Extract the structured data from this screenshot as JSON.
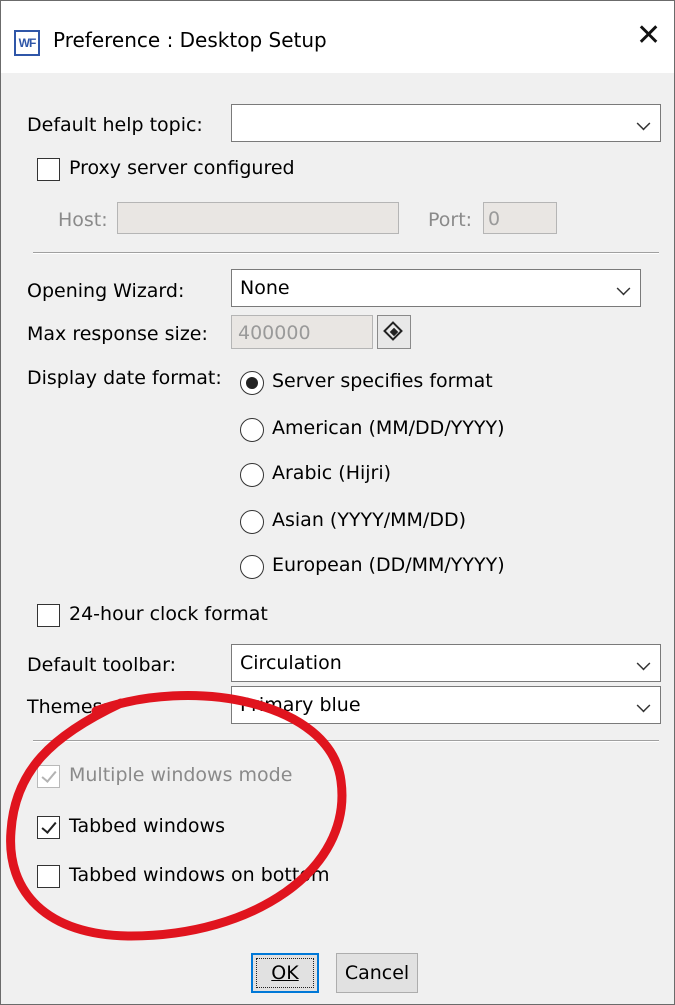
{
  "window": {
    "app_icon_text": "WF",
    "title": "Preference : Desktop Setup",
    "close_glyph": "✕"
  },
  "help": {
    "label": "Default help topic:",
    "value": ""
  },
  "proxy": {
    "label": "Proxy server configured",
    "checked": false,
    "host_label": "Host:",
    "host_value": "",
    "port_label": "Port:",
    "port_value": "0"
  },
  "wizard": {
    "label": "Opening Wizard:",
    "value": "None"
  },
  "max_response": {
    "label": "Max response size:",
    "value": "400000"
  },
  "date_format": {
    "label": "Display date format:",
    "options": [
      {
        "label": "Server specifies format",
        "selected": true
      },
      {
        "label": "American (MM/DD/YYYY)",
        "selected": false
      },
      {
        "label": "Arabic (Hijri)",
        "selected": false
      },
      {
        "label": "Asian (YYYY/MM/DD)",
        "selected": false
      },
      {
        "label": "European (DD/MM/YYYY)",
        "selected": false
      }
    ]
  },
  "clock": {
    "label": "24-hour clock format",
    "checked": false
  },
  "toolbar": {
    "label": "Default toolbar:",
    "value": "Circulation"
  },
  "themes": {
    "label": "Themes:",
    "value": "Primary blue"
  },
  "windows": {
    "multiple_label": "Multiple windows mode",
    "multiple_checked": true,
    "multiple_disabled": true,
    "tabbed_label": "Tabbed windows",
    "tabbed_checked": true,
    "tabbed_bottom_label": "Tabbed windows on bottom",
    "tabbed_bottom_checked": false
  },
  "buttons": {
    "ok": "OK",
    "cancel": "Cancel"
  },
  "colors": {
    "annotation": "#e0141e",
    "focus": "#0078d7",
    "dialog_bg": "#f0f0f0"
  }
}
